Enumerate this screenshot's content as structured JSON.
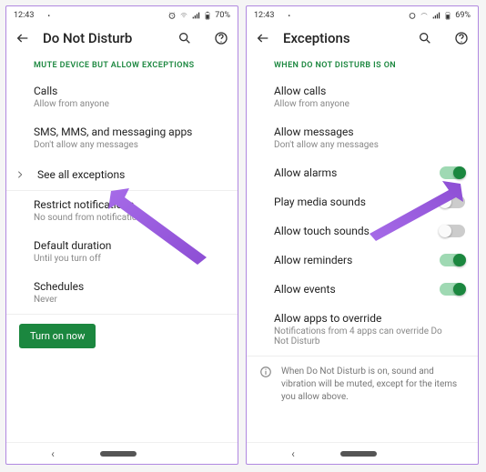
{
  "left": {
    "status": {
      "time": "12:43",
      "battery": "70%"
    },
    "title": "Do Not Disturb",
    "section": "MUTE DEVICE BUT ALLOW EXCEPTIONS",
    "calls": {
      "label": "Calls",
      "sub": "Allow from anyone"
    },
    "sms": {
      "label": "SMS, MMS, and messaging apps",
      "sub": "Don't allow any messages"
    },
    "see_all": "See all exceptions",
    "restrict": {
      "label": "Restrict notifications",
      "sub": "No sound from notifications"
    },
    "duration": {
      "label": "Default duration",
      "sub": "Until you turn off"
    },
    "schedules": {
      "label": "Schedules",
      "sub": "Never"
    },
    "turn_on": "Turn on now"
  },
  "right": {
    "status": {
      "time": "12:43",
      "battery": "69%"
    },
    "title": "Exceptions",
    "section": "WHEN DO NOT DISTURB IS ON",
    "allow_calls": {
      "label": "Allow calls",
      "sub": "Allow from anyone"
    },
    "allow_messages": {
      "label": "Allow messages",
      "sub": "Don't allow any messages"
    },
    "allow_alarms": "Allow alarms",
    "play_media": "Play media sounds",
    "allow_touch": "Allow touch sounds",
    "allow_reminders": "Allow reminders",
    "allow_events": "Allow events",
    "override": {
      "label": "Allow apps to override",
      "sub": "Notifications from 4 apps can override Do Not Disturb"
    },
    "info": "When Do Not Disturb is on, sound and vibration will be muted, except for the items you allow above."
  }
}
